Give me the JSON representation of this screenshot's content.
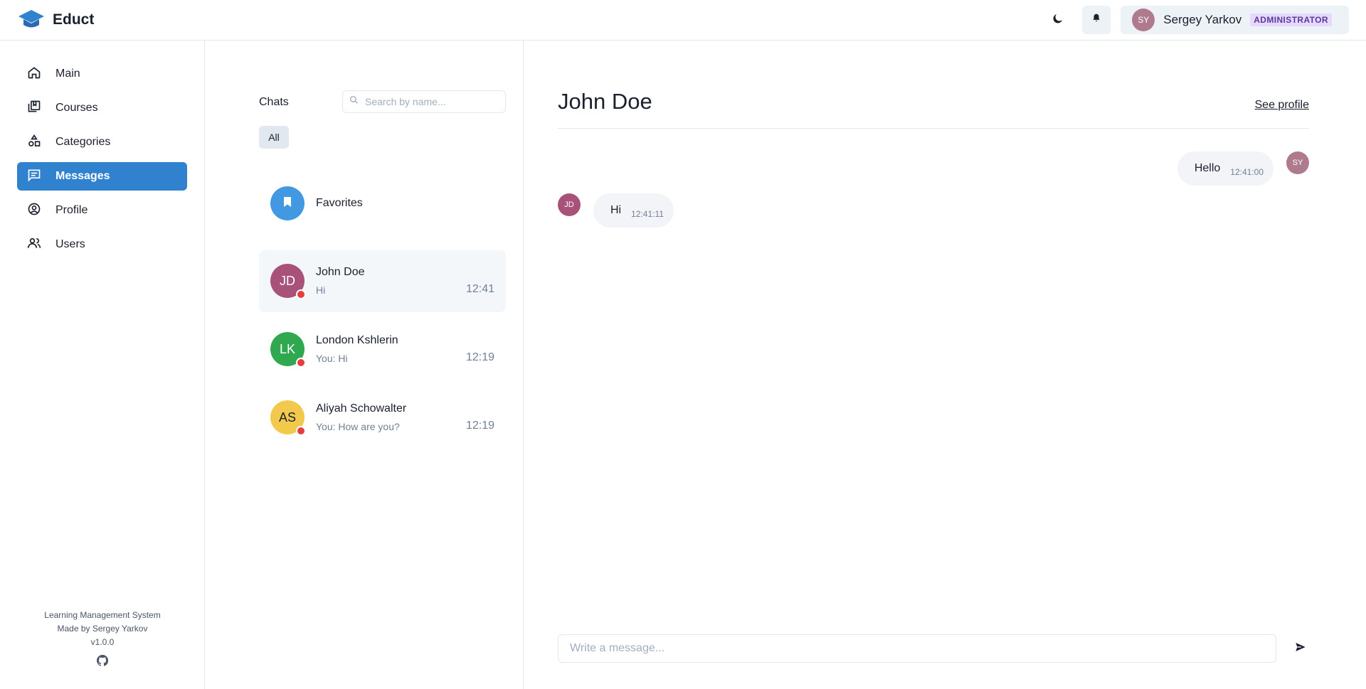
{
  "header": {
    "brand_name": "Educt",
    "user": {
      "initials": "SY",
      "name": "Sergey Yarkov",
      "role": "ADMINISTRATOR"
    },
    "icons": {
      "logo": "graduation-cap-icon",
      "theme": "moon-icon",
      "notifications": "bell-icon"
    }
  },
  "sidebar": {
    "items": [
      {
        "label": "Main",
        "icon": "home-icon",
        "active": false
      },
      {
        "label": "Courses",
        "icon": "library-icon",
        "active": false
      },
      {
        "label": "Categories",
        "icon": "shapes-icon",
        "active": false
      },
      {
        "label": "Messages",
        "icon": "message-icon",
        "active": true
      },
      {
        "label": "Profile",
        "icon": "user-circle-icon",
        "active": false
      },
      {
        "label": "Users",
        "icon": "users-icon",
        "active": false
      }
    ],
    "footer": {
      "line1": "Learning Management System",
      "line2": "Made by Sergey Yarkov",
      "version": "v1.0.0",
      "icon": "github-icon"
    }
  },
  "chatlist": {
    "title": "Chats",
    "search_placeholder": "Search by name...",
    "filter_all": "All",
    "favorites_label": "Favorites",
    "chats": [
      {
        "initials": "JD",
        "name": "John Doe",
        "preview": "Hi",
        "time": "12:41",
        "color": "#a8527a",
        "active": true
      },
      {
        "initials": "LK",
        "name": "London Kshlerin",
        "preview": "You: Hi",
        "time": "12:19",
        "color": "#2fa84f",
        "active": false
      },
      {
        "initials": "AS",
        "name": "Aliyah Schowalter",
        "preview": "You: How are you?",
        "time": "12:19",
        "color": "#f2c94c",
        "active": false
      }
    ]
  },
  "conversation": {
    "title": "John Doe",
    "see_profile": "See profile",
    "messages": [
      {
        "text": "Hello",
        "time": "12:41:00",
        "initials": "SY",
        "outgoing": true
      },
      {
        "text": "Hi",
        "time": "12:41:11",
        "initials": "JD",
        "outgoing": false
      }
    ],
    "composer_placeholder": "Write a message...",
    "send_icon": "send-icon"
  },
  "colors": {
    "accent": "#3182ce",
    "unread": "#e53e3e",
    "favorites": "#4299e1"
  }
}
